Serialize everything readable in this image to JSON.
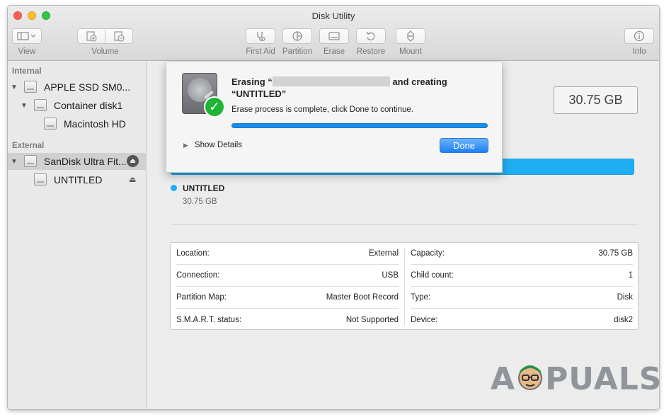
{
  "window": {
    "title": "Disk Utility"
  },
  "toolbar": {
    "view_label": "View",
    "volume_label": "Volume",
    "first_aid_label": "First Aid",
    "partition_label": "Partition",
    "erase_label": "Erase",
    "restore_label": "Restore",
    "mount_label": "Mount",
    "info_label": "Info"
  },
  "sidebar": {
    "internal_header": "Internal",
    "external_header": "External",
    "items": [
      {
        "label": "APPLE SSD SM0...",
        "level": 0,
        "section": "Internal"
      },
      {
        "label": "Container disk1",
        "level": 1,
        "section": "Internal"
      },
      {
        "label": "Macintosh HD",
        "level": 2,
        "section": "Internal"
      },
      {
        "label": "SanDisk Ultra Fit...",
        "level": 0,
        "section": "External",
        "selected": true
      },
      {
        "label": "UNTITLED",
        "level": 1,
        "section": "External"
      }
    ]
  },
  "main": {
    "capacity": "30.75 GB",
    "volume_name": "UNTITLED",
    "volume_size": "30.75 GB",
    "accent_color": "#1faef3"
  },
  "info": {
    "left": [
      {
        "label": "Location:",
        "value": "External"
      },
      {
        "label": "Connection:",
        "value": "USB"
      },
      {
        "label": "Partition Map:",
        "value": "Master Boot Record"
      },
      {
        "label": "S.M.A.R.T. status:",
        "value": "Not Supported"
      }
    ],
    "right": [
      {
        "label": "Capacity:",
        "value": "30.75 GB"
      },
      {
        "label": "Child count:",
        "value": "1"
      },
      {
        "label": "Type:",
        "value": "Disk"
      },
      {
        "label": "Device:",
        "value": "disk2"
      }
    ]
  },
  "dialog": {
    "title_prefix": "Erasing “",
    "title_suffix": " and creating",
    "title_line2": "“UNTITLED”",
    "message": "Erase process is complete, click Done to continue.",
    "progress_fraction": 1.0,
    "show_details_label": "Show Details",
    "done_label": "Done"
  },
  "watermark": {
    "text_a": "A",
    "text_rest": "PUALS"
  }
}
